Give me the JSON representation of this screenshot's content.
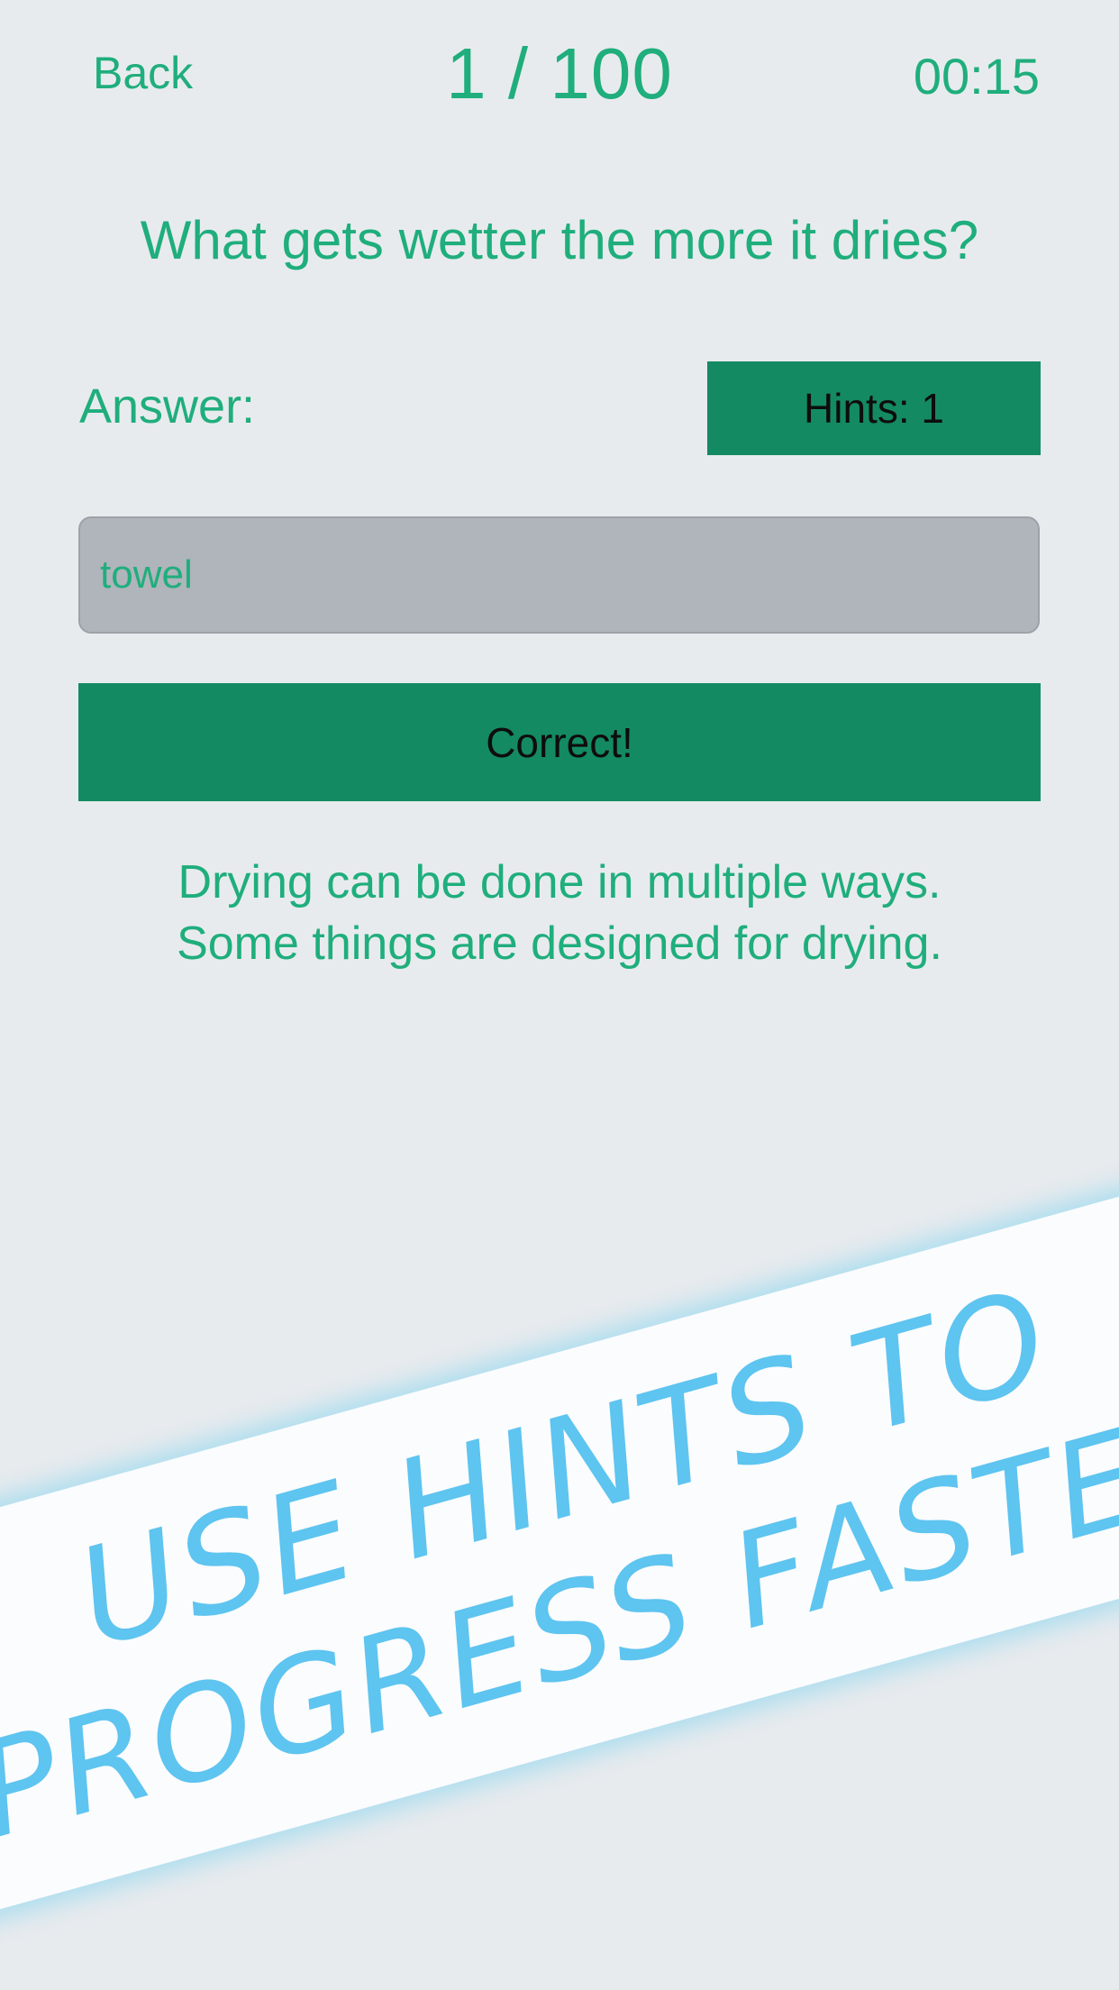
{
  "header": {
    "back_label": "Back",
    "progress": "1 / 100",
    "timer": "00:15"
  },
  "question": {
    "text": "What gets wetter the more it dries?"
  },
  "answer": {
    "label": "Answer:",
    "hints_button_label": "Hints: 1",
    "input_value": "towel",
    "check_button_label": "Correct!"
  },
  "hint": {
    "line1": "Drying can be done in multiple ways.",
    "line2": "Some things are designed for drying."
  },
  "promo_banner": {
    "line1": "USE HINTS TO",
    "line2": "PROGRESS FASTER"
  },
  "colors": {
    "background": "#e8ebee",
    "accent_text": "#1fae7c",
    "button_fill": "#148a62",
    "input_fill": "#b0b4bb",
    "banner_text": "#5ec4f0"
  }
}
